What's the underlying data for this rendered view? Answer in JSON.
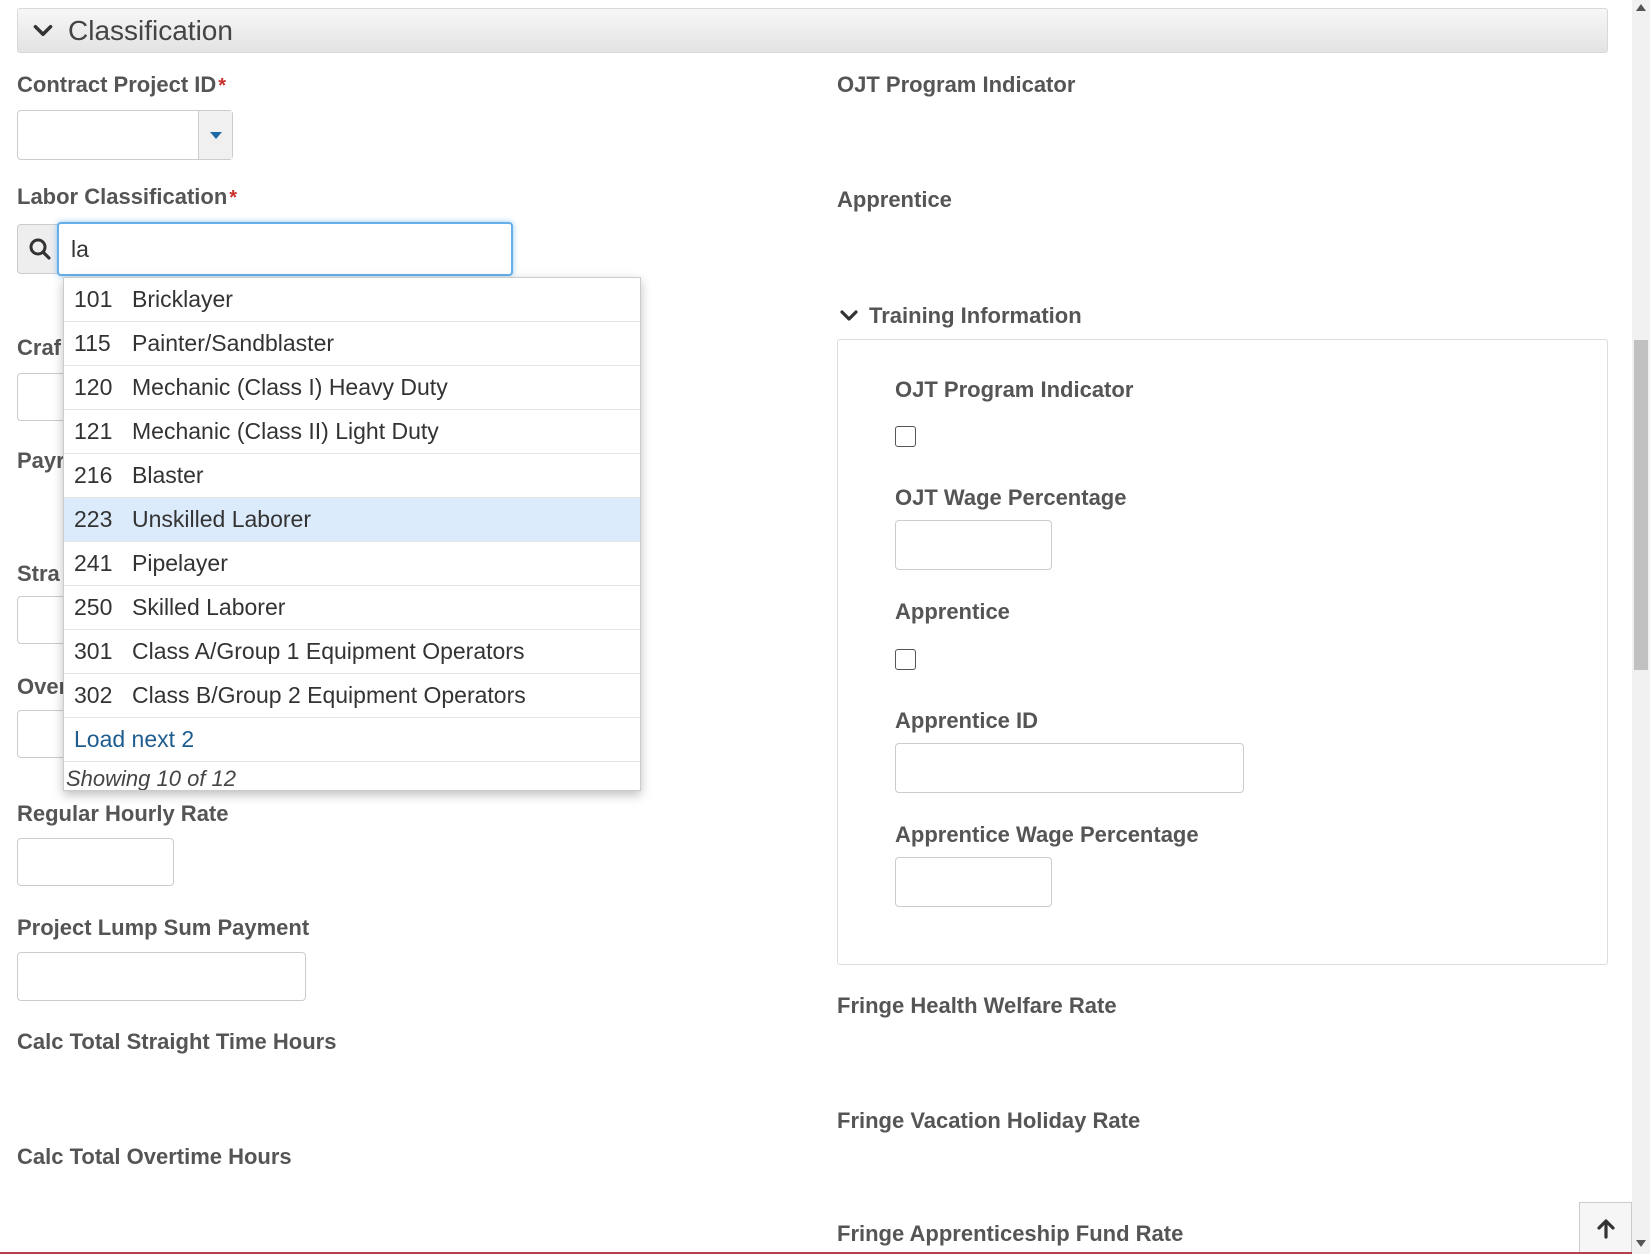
{
  "section": {
    "title": "Classification"
  },
  "left": {
    "contract_project_id": {
      "label": "Contract Project ID",
      "required": "*"
    },
    "labor_classification": {
      "label": "Labor Classification",
      "required": "*",
      "value": "la"
    },
    "partial_labels": {
      "craft": "Craf",
      "pay": "Payr",
      "straight": "Stra",
      "overtime": "Over"
    },
    "regular_hourly_rate": {
      "label": "Regular Hourly Rate"
    },
    "project_lump_sum": {
      "label": "Project Lump Sum Payment"
    },
    "calc_straight": {
      "label": "Calc Total Straight Time Hours"
    },
    "calc_overtime": {
      "label": "Calc Total Overtime Hours"
    }
  },
  "dropdown": {
    "items": [
      {
        "code": "101",
        "name": "Bricklayer"
      },
      {
        "code": "115",
        "name": "Painter/Sandblaster"
      },
      {
        "code": "120",
        "name": "Mechanic (Class I) Heavy Duty"
      },
      {
        "code": "121",
        "name": "Mechanic (Class II) Light Duty"
      },
      {
        "code": "216",
        "name": "Blaster"
      },
      {
        "code": "223",
        "name": "Unskilled Laborer"
      },
      {
        "code": "241",
        "name": "Pipelayer"
      },
      {
        "code": "250",
        "name": "Skilled Laborer"
      },
      {
        "code": "301",
        "name": "Class A/Group 1 Equipment Operators"
      },
      {
        "code": "302",
        "name": "Class B/Group 2 Equipment Operators"
      }
    ],
    "selected_code": "223",
    "load_next": "Load next 2",
    "showing": "Showing 10 of 12"
  },
  "right": {
    "ojt_program_indicator": {
      "label": "OJT Program Indicator"
    },
    "apprentice": {
      "label": "Apprentice"
    },
    "training": {
      "title": "Training Information",
      "ojt_program_indicator": "OJT Program Indicator",
      "ojt_wage_percentage": "OJT Wage Percentage",
      "apprentice": "Apprentice",
      "apprentice_id": "Apprentice ID",
      "apprentice_wage_percentage": "Apprentice Wage Percentage"
    },
    "fringe_health": {
      "label": "Fringe Health Welfare Rate"
    },
    "fringe_vacation": {
      "label": "Fringe Vacation Holiday Rate"
    },
    "fringe_apprenticeship": {
      "label": "Fringe Apprenticeship Fund Rate"
    }
  },
  "colors": {
    "required": "#c9302c",
    "focus": "#66afe9",
    "selected_row": "#dcebfb",
    "link": "#1f5d8f"
  },
  "icons": [
    "chevron-down-icon",
    "caret-down-icon",
    "search-icon",
    "arrow-up-icon"
  ]
}
